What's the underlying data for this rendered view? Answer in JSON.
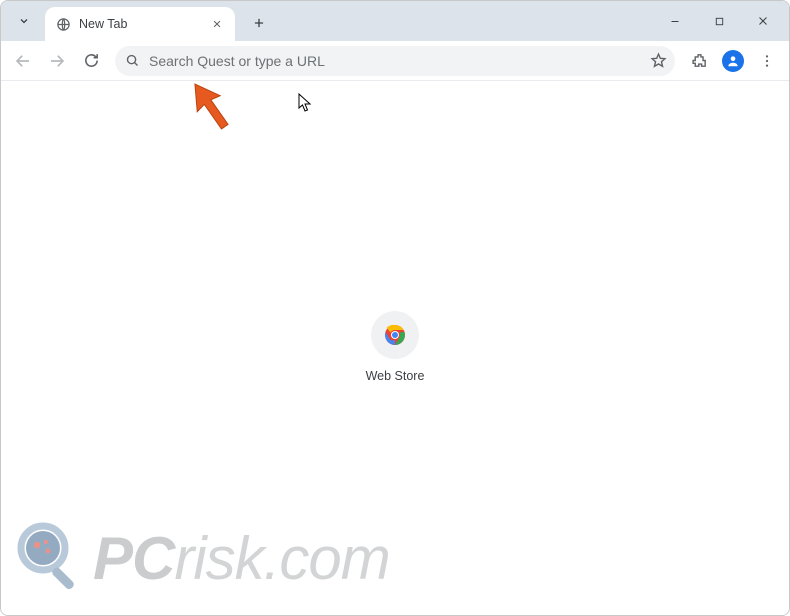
{
  "tab": {
    "title": "New Tab"
  },
  "omnibox": {
    "placeholder": "Search Quest or type a URL",
    "value": ""
  },
  "shortcuts": [
    {
      "label": "Web Store"
    }
  ],
  "watermark": {
    "text_pc": "PC",
    "text_rest": "risk.com"
  }
}
